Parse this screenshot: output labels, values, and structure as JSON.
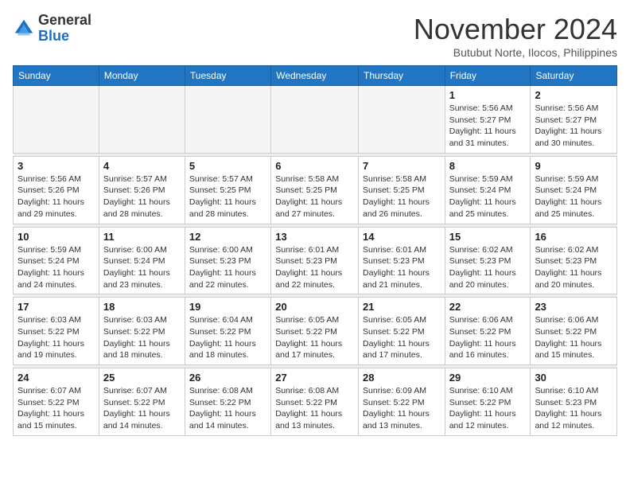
{
  "header": {
    "logo_general": "General",
    "logo_blue": "Blue",
    "month": "November 2024",
    "location": "Butubut Norte, Ilocos, Philippines"
  },
  "weekdays": [
    "Sunday",
    "Monday",
    "Tuesday",
    "Wednesday",
    "Thursday",
    "Friday",
    "Saturday"
  ],
  "weeks": [
    [
      {
        "day": "",
        "info": ""
      },
      {
        "day": "",
        "info": ""
      },
      {
        "day": "",
        "info": ""
      },
      {
        "day": "",
        "info": ""
      },
      {
        "day": "",
        "info": ""
      },
      {
        "day": "1",
        "info": "Sunrise: 5:56 AM\nSunset: 5:27 PM\nDaylight: 11 hours and 31 minutes."
      },
      {
        "day": "2",
        "info": "Sunrise: 5:56 AM\nSunset: 5:27 PM\nDaylight: 11 hours and 30 minutes."
      }
    ],
    [
      {
        "day": "3",
        "info": "Sunrise: 5:56 AM\nSunset: 5:26 PM\nDaylight: 11 hours and 29 minutes."
      },
      {
        "day": "4",
        "info": "Sunrise: 5:57 AM\nSunset: 5:26 PM\nDaylight: 11 hours and 28 minutes."
      },
      {
        "day": "5",
        "info": "Sunrise: 5:57 AM\nSunset: 5:25 PM\nDaylight: 11 hours and 28 minutes."
      },
      {
        "day": "6",
        "info": "Sunrise: 5:58 AM\nSunset: 5:25 PM\nDaylight: 11 hours and 27 minutes."
      },
      {
        "day": "7",
        "info": "Sunrise: 5:58 AM\nSunset: 5:25 PM\nDaylight: 11 hours and 26 minutes."
      },
      {
        "day": "8",
        "info": "Sunrise: 5:59 AM\nSunset: 5:24 PM\nDaylight: 11 hours and 25 minutes."
      },
      {
        "day": "9",
        "info": "Sunrise: 5:59 AM\nSunset: 5:24 PM\nDaylight: 11 hours and 25 minutes."
      }
    ],
    [
      {
        "day": "10",
        "info": "Sunrise: 5:59 AM\nSunset: 5:24 PM\nDaylight: 11 hours and 24 minutes."
      },
      {
        "day": "11",
        "info": "Sunrise: 6:00 AM\nSunset: 5:24 PM\nDaylight: 11 hours and 23 minutes."
      },
      {
        "day": "12",
        "info": "Sunrise: 6:00 AM\nSunset: 5:23 PM\nDaylight: 11 hours and 22 minutes."
      },
      {
        "day": "13",
        "info": "Sunrise: 6:01 AM\nSunset: 5:23 PM\nDaylight: 11 hours and 22 minutes."
      },
      {
        "day": "14",
        "info": "Sunrise: 6:01 AM\nSunset: 5:23 PM\nDaylight: 11 hours and 21 minutes."
      },
      {
        "day": "15",
        "info": "Sunrise: 6:02 AM\nSunset: 5:23 PM\nDaylight: 11 hours and 20 minutes."
      },
      {
        "day": "16",
        "info": "Sunrise: 6:02 AM\nSunset: 5:23 PM\nDaylight: 11 hours and 20 minutes."
      }
    ],
    [
      {
        "day": "17",
        "info": "Sunrise: 6:03 AM\nSunset: 5:22 PM\nDaylight: 11 hours and 19 minutes."
      },
      {
        "day": "18",
        "info": "Sunrise: 6:03 AM\nSunset: 5:22 PM\nDaylight: 11 hours and 18 minutes."
      },
      {
        "day": "19",
        "info": "Sunrise: 6:04 AM\nSunset: 5:22 PM\nDaylight: 11 hours and 18 minutes."
      },
      {
        "day": "20",
        "info": "Sunrise: 6:05 AM\nSunset: 5:22 PM\nDaylight: 11 hours and 17 minutes."
      },
      {
        "day": "21",
        "info": "Sunrise: 6:05 AM\nSunset: 5:22 PM\nDaylight: 11 hours and 17 minutes."
      },
      {
        "day": "22",
        "info": "Sunrise: 6:06 AM\nSunset: 5:22 PM\nDaylight: 11 hours and 16 minutes."
      },
      {
        "day": "23",
        "info": "Sunrise: 6:06 AM\nSunset: 5:22 PM\nDaylight: 11 hours and 15 minutes."
      }
    ],
    [
      {
        "day": "24",
        "info": "Sunrise: 6:07 AM\nSunset: 5:22 PM\nDaylight: 11 hours and 15 minutes."
      },
      {
        "day": "25",
        "info": "Sunrise: 6:07 AM\nSunset: 5:22 PM\nDaylight: 11 hours and 14 minutes."
      },
      {
        "day": "26",
        "info": "Sunrise: 6:08 AM\nSunset: 5:22 PM\nDaylight: 11 hours and 14 minutes."
      },
      {
        "day": "27",
        "info": "Sunrise: 6:08 AM\nSunset: 5:22 PM\nDaylight: 11 hours and 13 minutes."
      },
      {
        "day": "28",
        "info": "Sunrise: 6:09 AM\nSunset: 5:22 PM\nDaylight: 11 hours and 13 minutes."
      },
      {
        "day": "29",
        "info": "Sunrise: 6:10 AM\nSunset: 5:22 PM\nDaylight: 11 hours and 12 minutes."
      },
      {
        "day": "30",
        "info": "Sunrise: 6:10 AM\nSunset: 5:23 PM\nDaylight: 11 hours and 12 minutes."
      }
    ]
  ]
}
